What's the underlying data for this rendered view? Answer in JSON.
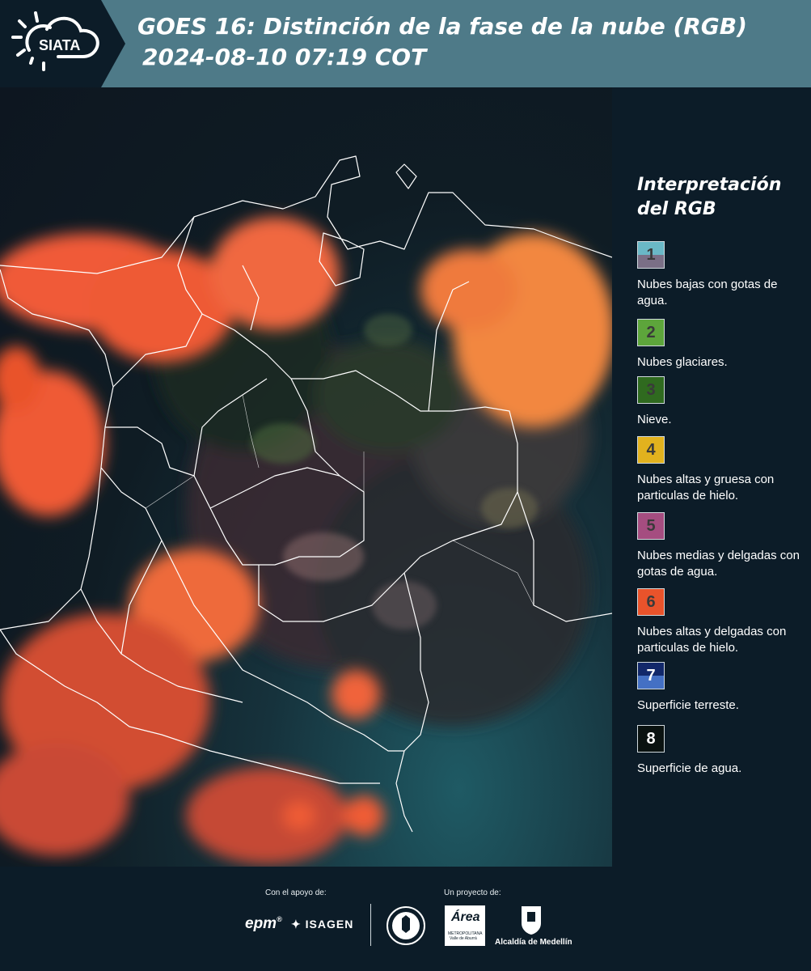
{
  "header": {
    "logo_text": "SIATA",
    "title_line1": "GOES 16: Distinción de la fase de la nube (RGB)",
    "title_line2": "2024-08-10 07:19 COT"
  },
  "legend": {
    "title_line1": "Interpretación",
    "title_line2": "del RGB",
    "items": [
      {
        "num": "1",
        "label": "Nubes bajas con gotas de agua.",
        "color_top": "#6ab8c6",
        "color_bottom": "#7a6f86"
      },
      {
        "num": "2",
        "label": "Nubes glaciares.",
        "color_top": "#5da53b",
        "color_bottom": "#5da53b"
      },
      {
        "num": "3",
        "label": "Nieve.",
        "color_top": "#2f6a1f",
        "color_bottom": "#2f6a1f"
      },
      {
        "num": "4",
        "label": "Nubes altas y gruesa con particulas de hielo.",
        "color_top": "#e2b21e",
        "color_bottom": "#e2b21e"
      },
      {
        "num": "5",
        "label": "Nubes medias y delgadas con gotas de agua.",
        "color_top": "#a54d80",
        "color_bottom": "#a54d80"
      },
      {
        "num": "6",
        "label": "Nubes altas y delgadas con particulas de hielo.",
        "color_top": "#e9532b",
        "color_bottom": "#e9532b"
      },
      {
        "num": "7",
        "label": "Superficie terreste.",
        "color_top": "#12286a",
        "color_bottom": "#4470c4"
      },
      {
        "num": "8",
        "label": "Superficie de agua.",
        "color_top": "#0a1210",
        "color_bottom": "#0a1210"
      }
    ]
  },
  "footer": {
    "support_label": "Con el apoyo de:",
    "project_label": "Un proyecto de:",
    "epm": "epm",
    "isagen": "ISAGEN",
    "area_name": "Área",
    "area_sub1": "METROPOLITANA",
    "area_sub2": "Valle de Aburrá",
    "alcaldia": "Alcaldía de Medellín"
  }
}
